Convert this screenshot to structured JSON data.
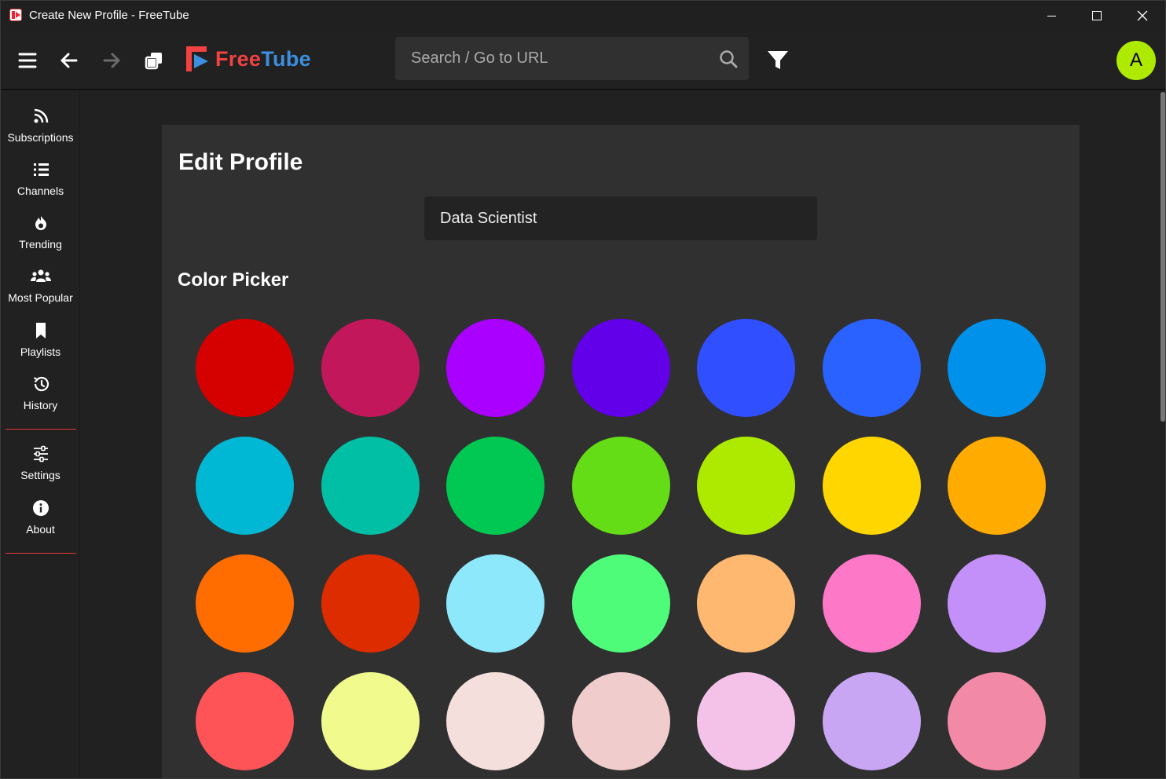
{
  "window": {
    "title": "Create New Profile - FreeTube"
  },
  "topnav": {
    "logo_part1": "Free",
    "logo_part2": "Tube",
    "search_placeholder": "Search / Go to URL",
    "avatar_letter": "A",
    "avatar_color": "#aeea00"
  },
  "sidebar": {
    "items": [
      {
        "label": "Subscriptions",
        "icon": "rss-icon"
      },
      {
        "label": "Channels",
        "icon": "list-icon"
      },
      {
        "label": "Trending",
        "icon": "fire-icon"
      },
      {
        "label": "Most Popular",
        "icon": "users-icon"
      },
      {
        "label": "Playlists",
        "icon": "bookmark-icon"
      },
      {
        "label": "History",
        "icon": "history-icon"
      },
      {
        "label": "Settings",
        "icon": "sliders-icon"
      },
      {
        "label": "About",
        "icon": "info-icon"
      }
    ]
  },
  "profile": {
    "heading": "Edit Profile",
    "name_value": "Data Scientist",
    "color_picker_heading": "Color Picker",
    "colors": [
      "#d50000",
      "#c2185b",
      "#aa00ff",
      "#6200ea",
      "#304ffe",
      "#2962ff",
      "#0091ea",
      "#00b8d4",
      "#00bfa5",
      "#00c853",
      "#64dd17",
      "#aeea00",
      "#ffd600",
      "#ffab00",
      "#ff6d00",
      "#dd2c00",
      "#8de8fc",
      "#4efc7a",
      "#feb870",
      "#fe78c8",
      "#c290f8",
      "#fe5457",
      "#f0fa8d",
      "#f5dfdc",
      "#f0cccc",
      "#f4c2e8",
      "#c9a6f4",
      "#f28aa7"
    ]
  }
}
